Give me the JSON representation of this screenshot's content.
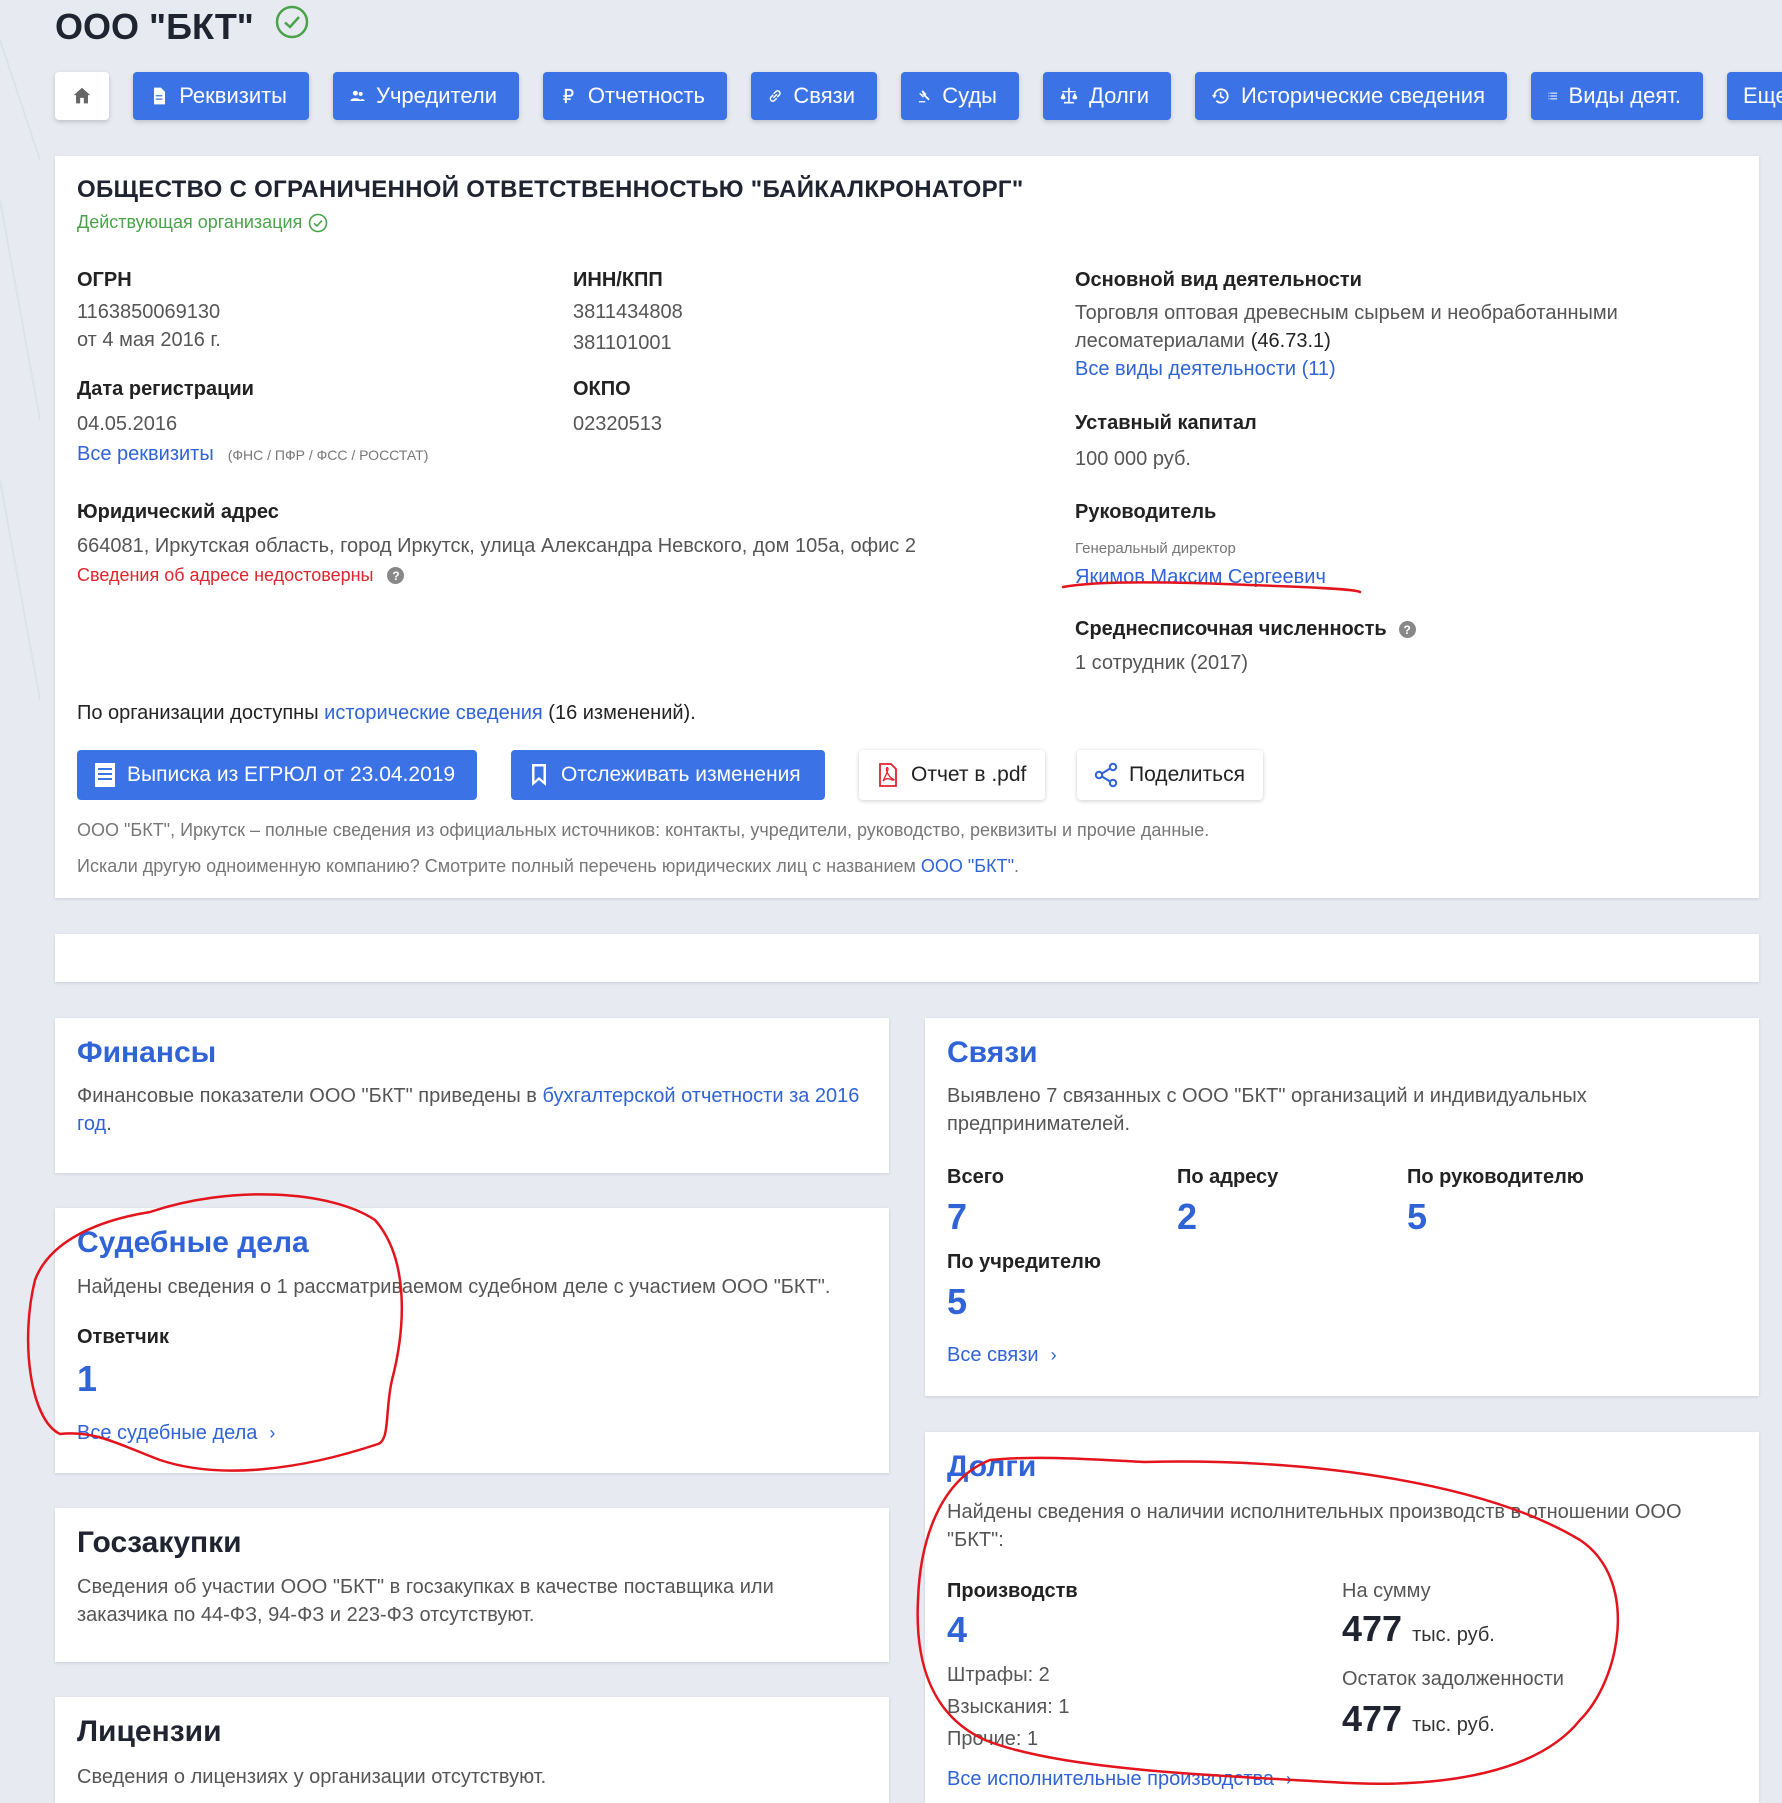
{
  "header": {
    "title": "ООО \"БКТ\""
  },
  "tabs": [
    {
      "label": "Реквизиты",
      "icon": "document-icon"
    },
    {
      "label": "Учредители",
      "icon": "people-icon"
    },
    {
      "label": "Отчетность",
      "icon": "ruble-icon"
    },
    {
      "label": "Связи",
      "icon": "link-icon"
    },
    {
      "label": "Суды",
      "icon": "gavel-icon"
    },
    {
      "label": "Долги",
      "icon": "scales-icon"
    },
    {
      "label": "Исторические сведения",
      "icon": "history-icon"
    },
    {
      "label": "Виды деят.",
      "icon": "list-icon"
    },
    {
      "label": "Еще",
      "icon": ""
    }
  ],
  "org": {
    "full_name": "ОБЩЕСТВО С ОГРАНИЧЕННОЙ ОТВЕТСТВЕННОСТЬЮ \"БАЙКАЛКРОНАТОРГ\"",
    "status": "Действующая организация",
    "ogrn_label": "ОГРН",
    "ogrn": "1163850069130",
    "ogrn_date": "от 4 мая 2016 г.",
    "inn_label": "ИНН/КПП",
    "inn": "3811434808",
    "kpp": "381101001",
    "reg_label": "Дата регистрации",
    "reg_date": "04.05.2016",
    "okpo_label": "ОКПО",
    "okpo": "02320513",
    "all_req_link": "Все реквизиты",
    "all_req_sources": "(ФНС / ПФР / ФСС / РОССТАТ)",
    "address_label": "Юридический адрес",
    "address": "664081, Иркутская область, город Иркутск, улица Александра Невского, дом 105а, офис 2",
    "address_warning": "Сведения об адресе недостоверны",
    "activity_label": "Основной вид деятельности",
    "activity_line1": "Торговля оптовая древесным сырьем и необработанными",
    "activity_line2": "лесоматериалами",
    "activity_code": "(46.73.1)",
    "activity_all_link": "Все виды деятельности (11)",
    "capital_label": "Уставный капитал",
    "capital": "100 000 руб.",
    "head_label": "Руководитель",
    "head_position": "Генеральный директор",
    "head_name": "Якимов Максим Сергеевич",
    "staff_label": "Среднесписочная численность",
    "staff": "1 сотрудник (2017)",
    "history_prefix": "По организации доступны",
    "history_link": "исторические сведения",
    "history_suffix": "(16 изменений).",
    "btn_egrul": "Выписка из ЕГРЮЛ от 23.04.2019",
    "btn_track": "Отслеживать изменения",
    "btn_pdf": "Отчет в .pdf",
    "btn_share": "Поделиться",
    "note1": "ООО \"БКТ\", Иркутск – полные сведения из официальных источников: контакты, учредители, руководство, реквизиты и прочие данные.",
    "note2_prefix": "Искали другую одноименную компанию? Смотрите полный перечень юридических лиц с названием",
    "note2_link": "ООО \"БКТ\"",
    "note2_suffix": "."
  },
  "finance": {
    "title": "Финансы",
    "text_prefix": "Финансовые показатели ООО \"БКТ\" приведены в",
    "text_link_1": "бухгалтерской отчетности за",
    "text_link_2": "2016 год",
    "text_suffix": "."
  },
  "courts": {
    "title": "Судебные дела",
    "text": "Найдены сведения о 1 рассматриваемом судебном деле с участием ООО \"БКТ\".",
    "defendant_label": "Ответчик",
    "defendant_count": "1",
    "all_link": "Все судебные дела"
  },
  "procurement": {
    "title": "Госзакупки",
    "text_line1": "Сведения об участии ООО \"БКТ\" в госзакупках в качестве поставщика или",
    "text_line2": "заказчика по 44-ФЗ, 94-ФЗ и 223-ФЗ отсутствуют."
  },
  "licenses": {
    "title": "Лицензии",
    "text": "Сведения о лицензиях у организации отсутствуют."
  },
  "links": {
    "title": "Связи",
    "text_line1": "Выявлено 7 связанных с ООО \"БКТ\" организаций и индивидуальных",
    "text_line2": "предпринимателей.",
    "total_label": "Всего",
    "total": "7",
    "by_address_label": "По адресу",
    "by_address": "2",
    "by_head_label": "По руководителю",
    "by_head": "5",
    "by_founder_label": "По учредителю",
    "by_founder": "5",
    "all_link": "Все связи"
  },
  "debts": {
    "title": "Долги",
    "text_line1": "Найдены сведения о наличии исполнительных производств в отношении ООО",
    "text_line2": "\"БКТ\":",
    "proceedings_label": "Производств",
    "proceedings": "4",
    "fines": "Штрафы: 2",
    "recoveries": "Взыскания: 1",
    "other": "Прочие: 1",
    "sum_label": "На сумму",
    "sum": "477",
    "sum_unit": "тыс. руб.",
    "rest_label": "Остаток задолженности",
    "rest": "477",
    "rest_unit": "тыс. руб.",
    "all_link": "Все исполнительные производства"
  },
  "colors": {
    "accent": "#3b73e6",
    "link": "#2f63d6",
    "status_ok": "#4aa34a",
    "warning": "#e0242e",
    "annotation": "#e3141c"
  }
}
